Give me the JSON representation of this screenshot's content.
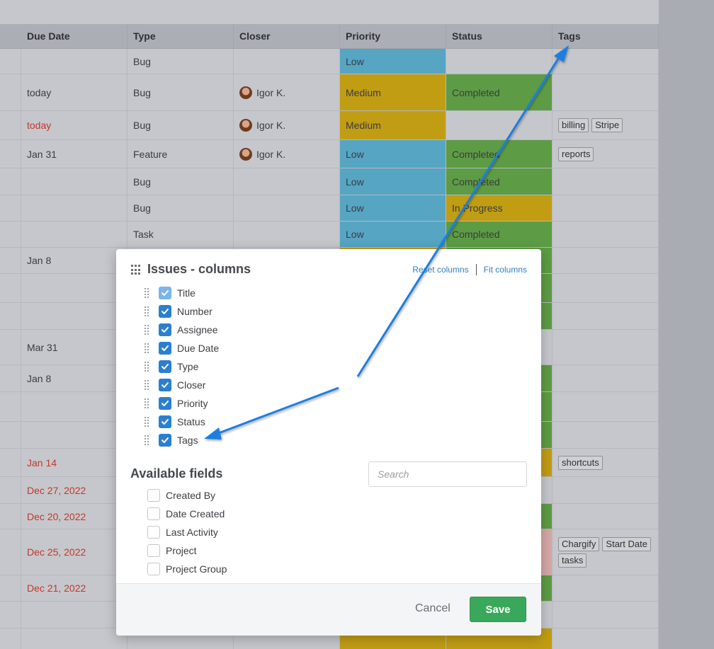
{
  "grid": {
    "headers": [
      "Due Date",
      "Type",
      "Closer",
      "Priority",
      "Status",
      "Tags"
    ],
    "rows": [
      {
        "due": "",
        "due_red": false,
        "type": "Bug",
        "closer": "",
        "priority": "Low",
        "status": "",
        "tags": []
      },
      {
        "due": "today",
        "due_red": false,
        "type": "Bug",
        "closer": "Igor K.",
        "priority": "Medium",
        "status": "Completed",
        "tags": []
      },
      {
        "due": "today",
        "due_red": true,
        "type": "Bug",
        "closer": "Igor K.",
        "priority": "Medium",
        "status": "",
        "tags": [
          "billing",
          "Stripe"
        ]
      },
      {
        "due": "Jan 31",
        "due_red": false,
        "type": "Feature",
        "closer": "Igor K.",
        "priority": "Low",
        "status": "Completed",
        "tags": [
          "reports"
        ]
      },
      {
        "due": "",
        "due_red": false,
        "type": "Bug",
        "closer": "",
        "priority": "Low",
        "status": "Completed",
        "tags": []
      },
      {
        "due": "",
        "due_red": false,
        "type": "Bug",
        "closer": "",
        "priority": "Low",
        "status": "In Progress",
        "tags": []
      },
      {
        "due": "",
        "due_red": false,
        "type": "Task",
        "closer": "",
        "priority": "Low",
        "status": "Completed",
        "tags": []
      },
      {
        "due": "Jan 8",
        "due_red": false,
        "type": "",
        "closer": "",
        "priority": "",
        "status": "",
        "tags": []
      },
      {
        "due": "",
        "due_red": false,
        "type": "",
        "closer": "",
        "priority": "",
        "status": "",
        "tags": []
      },
      {
        "due": "",
        "due_red": false,
        "type": "",
        "closer": "",
        "priority": "",
        "status": "",
        "tags": []
      },
      {
        "due": "Mar 31",
        "due_red": false,
        "type": "",
        "closer": "",
        "priority": "",
        "status": "",
        "tags": []
      },
      {
        "due": "Jan 8",
        "due_red": false,
        "type": "",
        "closer": "",
        "priority": "",
        "status": "",
        "tags": []
      },
      {
        "due": "",
        "due_red": false,
        "type": "",
        "closer": "",
        "priority": "",
        "status": "",
        "tags": []
      },
      {
        "due": "",
        "due_red": false,
        "type": "",
        "closer": "",
        "priority": "",
        "status": "",
        "tags": []
      },
      {
        "due": "Jan 14",
        "due_red": true,
        "type": "",
        "closer": "",
        "priority": "",
        "status": "",
        "tags": [
          "shortcuts"
        ]
      },
      {
        "due": "Dec 27, 2022",
        "due_red": true,
        "type": "",
        "closer": "",
        "priority": "",
        "status": "",
        "tags": []
      },
      {
        "due": "Dec 20, 2022",
        "due_red": true,
        "type": "",
        "closer": "",
        "priority": "",
        "status": "",
        "tags": []
      },
      {
        "due": "Dec 25, 2022",
        "due_red": true,
        "type": "",
        "closer": "",
        "priority": "",
        "status": "",
        "tags": [
          "Chargify",
          "Start Date",
          "tasks"
        ]
      },
      {
        "due": "Dec 21, 2022",
        "due_red": true,
        "type": "",
        "closer": "",
        "priority": "",
        "status": "",
        "tags": []
      },
      {
        "due": "",
        "due_red": false,
        "type": "",
        "closer": "",
        "priority": "",
        "status": "",
        "tags": []
      },
      {
        "due": "",
        "due_red": false,
        "type": "",
        "closer": "",
        "priority": "",
        "status": "",
        "tags": []
      }
    ],
    "status_fills": [
      "",
      "completed",
      "",
      "completed",
      "completed",
      "inprogress",
      "completed",
      "completed",
      "completed",
      "completed",
      "",
      "completed",
      "completed",
      "completed",
      "inprogress",
      "",
      "completed",
      "pink",
      "completed",
      "",
      "inprogress"
    ],
    "priority_fills": [
      "low",
      "medium",
      "medium",
      "low",
      "low",
      "low",
      "low",
      "medium",
      "",
      "",
      "",
      "",
      "",
      "",
      "",
      "",
      "",
      "",
      "",
      "",
      "medium"
    ]
  },
  "modal": {
    "title": "Issues - columns",
    "reset_label": "Reset columns",
    "fit_label": "Fit columns",
    "columns": [
      {
        "label": "Title",
        "checked": true,
        "locked": true
      },
      {
        "label": "Number",
        "checked": true,
        "locked": false
      },
      {
        "label": "Assignee",
        "checked": true,
        "locked": false
      },
      {
        "label": "Due Date",
        "checked": true,
        "locked": false
      },
      {
        "label": "Type",
        "checked": true,
        "locked": false
      },
      {
        "label": "Closer",
        "checked": true,
        "locked": false
      },
      {
        "label": "Priority",
        "checked": true,
        "locked": false
      },
      {
        "label": "Status",
        "checked": true,
        "locked": false
      },
      {
        "label": "Tags",
        "checked": true,
        "locked": false
      }
    ],
    "available_title": "Available fields",
    "search_placeholder": "Search",
    "available_fields": [
      "Created By",
      "Date Created",
      "Last Activity",
      "Project",
      "Project Group"
    ],
    "cancel_label": "Cancel",
    "save_label": "Save"
  },
  "colors": {
    "accent": "#2b7fd0",
    "save": "#3aa85a",
    "arrow": "#1a7fe0",
    "priority_low": "#56a5c3",
    "priority_medium": "#c19d14",
    "status_completed": "#5d9c45"
  }
}
